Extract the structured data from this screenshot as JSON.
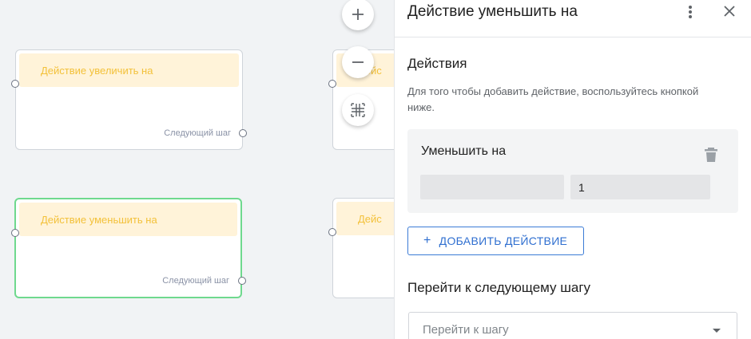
{
  "canvas": {
    "nodes": [
      {
        "title": "Действие увеличить на",
        "next_label": "Следующий шаг",
        "active": false
      },
      {
        "title": "Дейс",
        "next_label": "",
        "active": false
      },
      {
        "title": "Действие уменьшить на",
        "next_label": "Следующий шаг",
        "active": true
      },
      {
        "title": "Дейс",
        "next_label": "",
        "active": false
      }
    ],
    "zoom_controls": {
      "zoom_in_icon": "plus-icon",
      "zoom_out_icon": "minus-icon",
      "fit_icon": "fit-to-screen-icon"
    }
  },
  "panel": {
    "title": "Действие уменьшить на",
    "actions_heading": "Действия",
    "actions_hint": "Для того чтобы добавить действие, воспользуйтесь кнопкой ниже.",
    "action_card": {
      "title": "Уменьшить на",
      "field_1_value": "",
      "field_2_value": "1"
    },
    "add_action_label": "ДОБАВИТЬ ДЕЙСТВИЕ",
    "next_step_heading": "Перейти к следующему шагу",
    "next_step_placeholder": "Перейти к шагу"
  },
  "colors": {
    "active_node_border": "#6fd98e",
    "node_header_bg": "#fff3d9",
    "node_header_text": "#f3c13a",
    "accent": "#2f6fd0"
  }
}
